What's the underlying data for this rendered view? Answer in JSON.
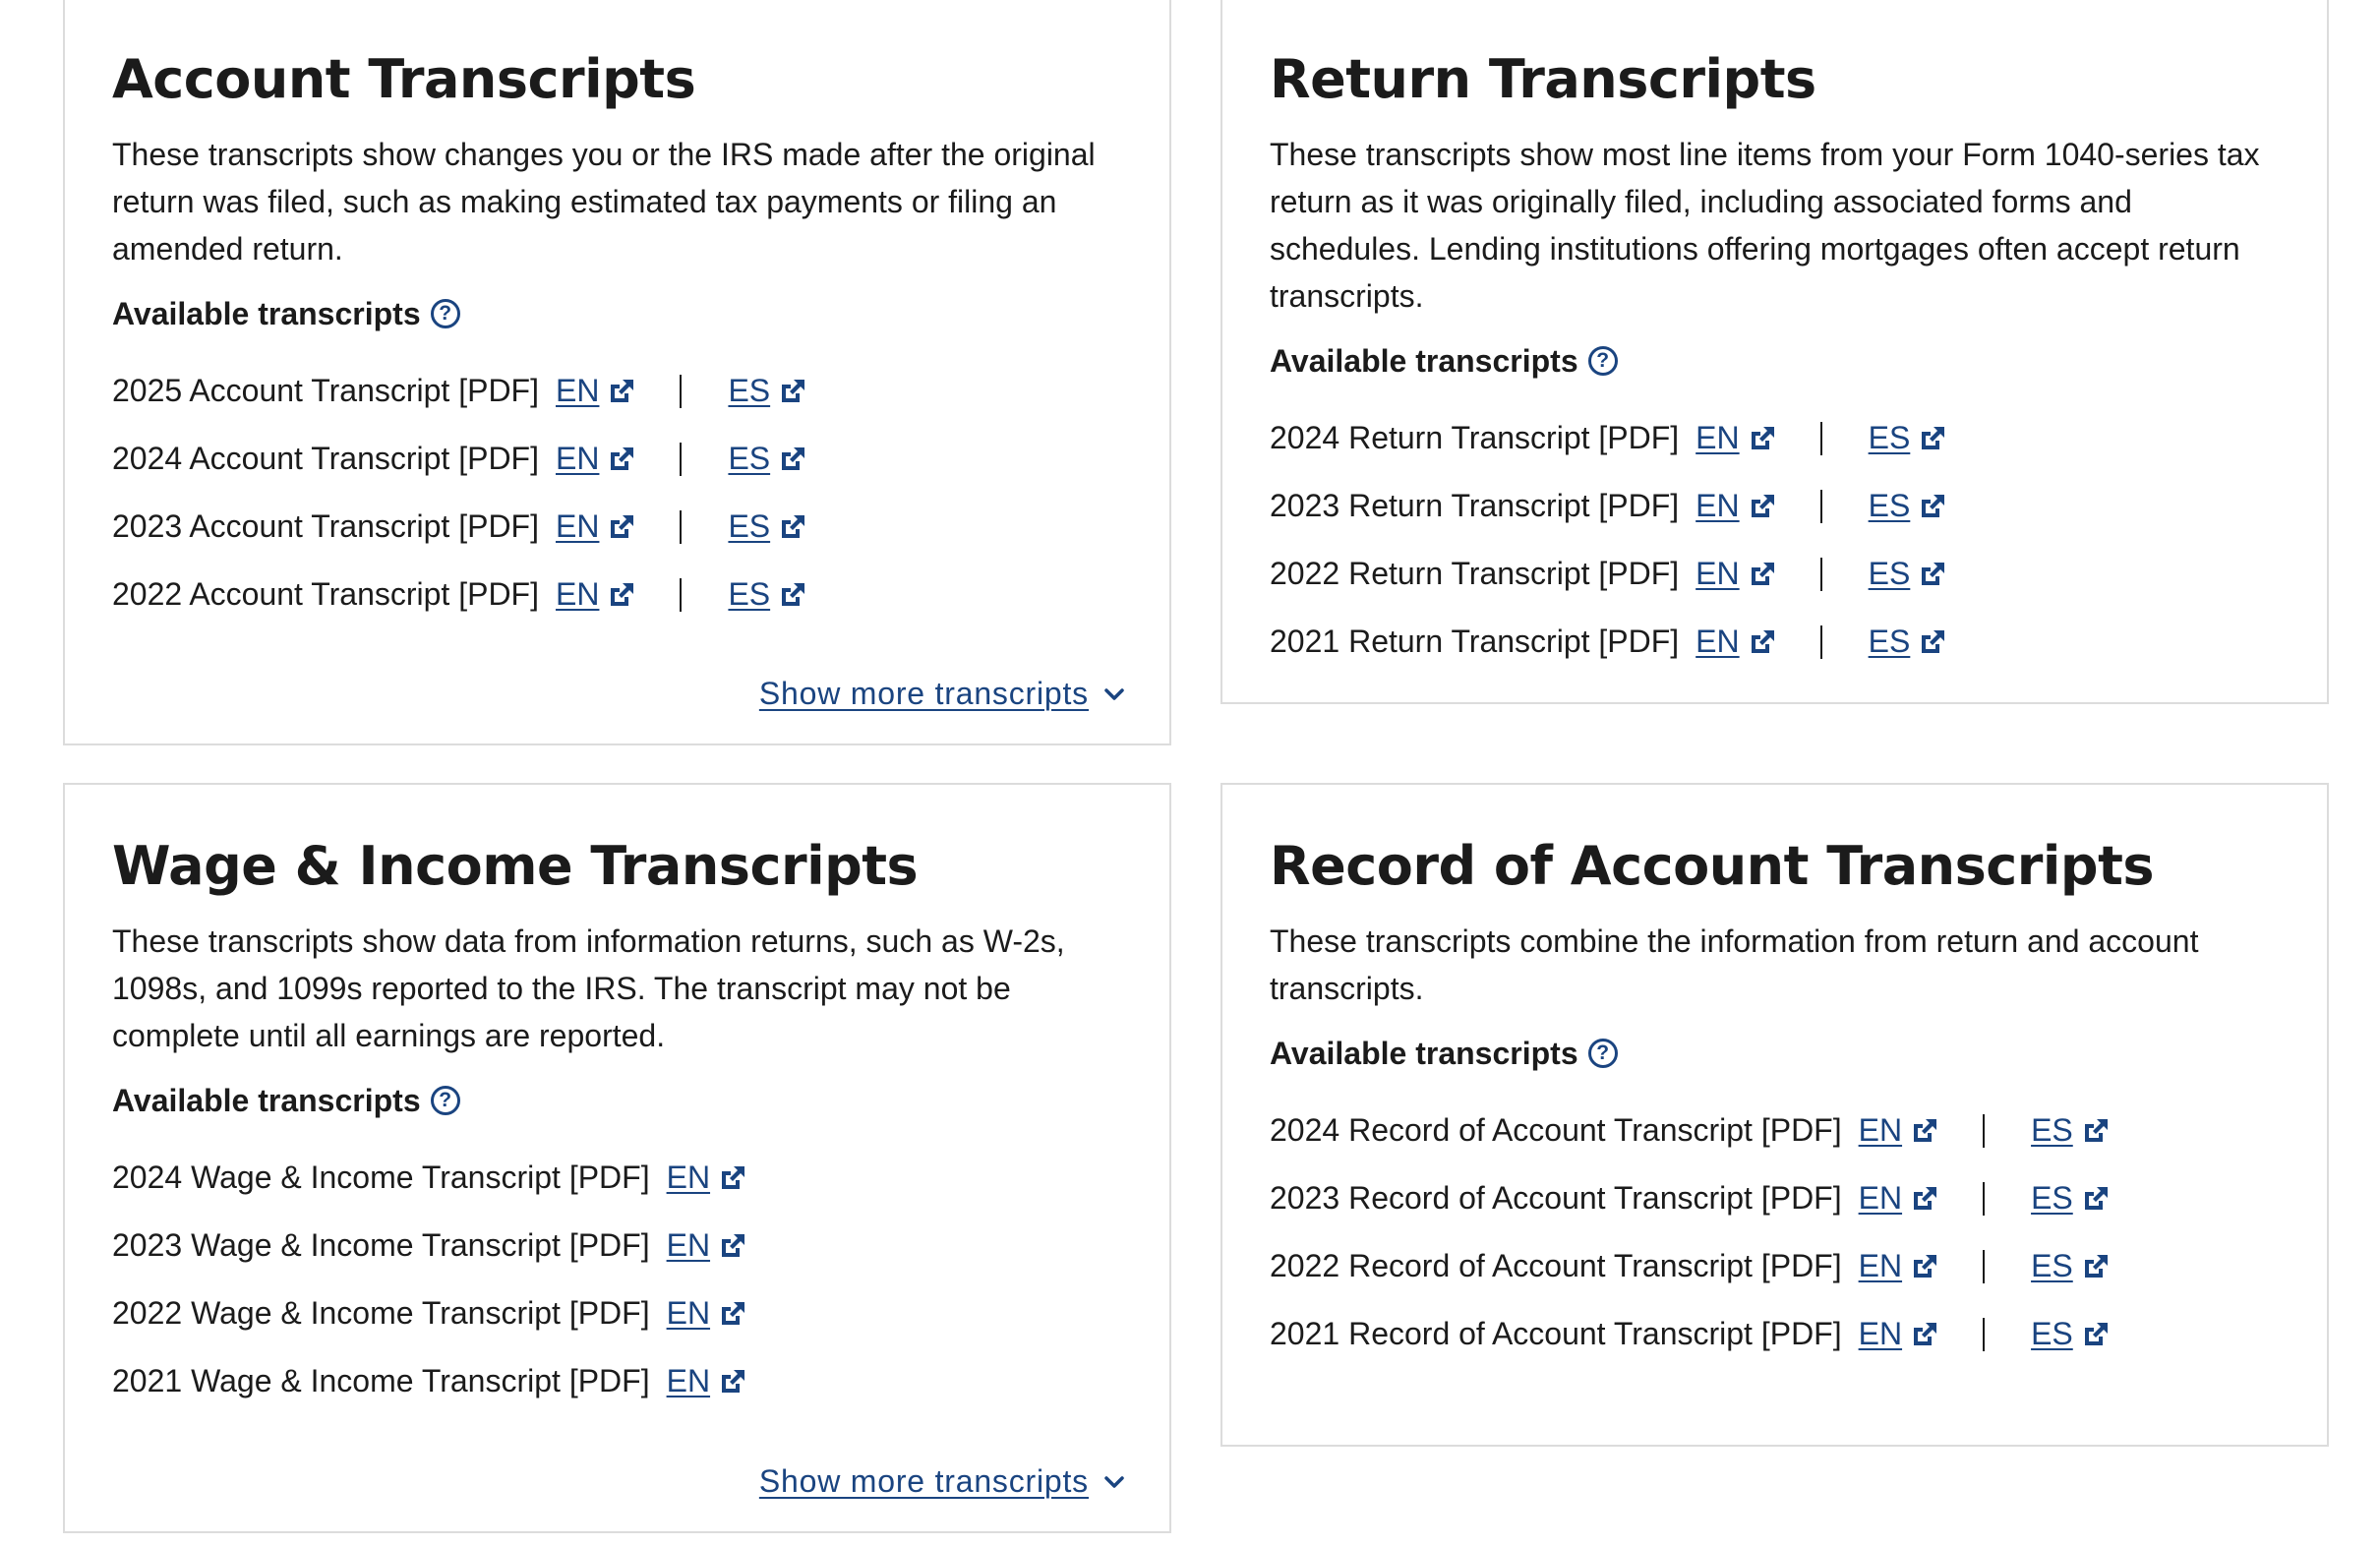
{
  "colors": {
    "link": "#1a4480",
    "text": "#1b1b1b",
    "border": "#dcdcdc"
  },
  "cards": {
    "account": {
      "title": "Account Transcripts",
      "description": "These transcripts show changes you or the IRS made after the original return was filed, such as making estimated tax payments or filing an amended return.",
      "available_label": "Available transcripts",
      "help_icon": "?",
      "rows": [
        {
          "label": "2025 Account Transcript [PDF]",
          "en": "EN",
          "es": "ES"
        },
        {
          "label": "2024 Account Transcript [PDF]",
          "en": "EN",
          "es": "ES"
        },
        {
          "label": "2023 Account Transcript [PDF]",
          "en": "EN",
          "es": "ES"
        },
        {
          "label": "2022 Account Transcript [PDF]",
          "en": "EN",
          "es": "ES"
        }
      ],
      "show_more": "Show more transcripts"
    },
    "return": {
      "title": "Return Transcripts",
      "description": "These transcripts show most line items from your Form 1040-series tax return as it was originally filed, including associated forms and schedules. Lending institutions offering mortgages often accept return transcripts.",
      "available_label": "Available transcripts",
      "help_icon": "?",
      "rows": [
        {
          "label": "2024 Return Transcript [PDF]",
          "en": "EN",
          "es": "ES"
        },
        {
          "label": "2023 Return Transcript [PDF]",
          "en": "EN",
          "es": "ES"
        },
        {
          "label": "2022 Return Transcript [PDF]",
          "en": "EN",
          "es": "ES"
        },
        {
          "label": "2021 Return Transcript [PDF]",
          "en": "EN",
          "es": "ES"
        }
      ]
    },
    "wage": {
      "title": "Wage & Income Transcripts",
      "description": "These transcripts show data from information returns, such as W-2s, 1098s, and 1099s reported to the IRS. The transcript may not be complete until all earnings are reported.",
      "available_label": "Available transcripts",
      "help_icon": "?",
      "rows": [
        {
          "label": "2024 Wage & Income Transcript [PDF]",
          "en": "EN"
        },
        {
          "label": "2023 Wage & Income Transcript [PDF]",
          "en": "EN"
        },
        {
          "label": "2022 Wage & Income Transcript [PDF]",
          "en": "EN"
        },
        {
          "label": "2021 Wage & Income Transcript [PDF]",
          "en": "EN"
        }
      ],
      "show_more": "Show more transcripts"
    },
    "record": {
      "title": "Record of Account Transcripts",
      "description": "These transcripts combine the information from return and account transcripts.",
      "available_label": "Available transcripts",
      "help_icon": "?",
      "rows": [
        {
          "label": "2024 Record of Account Transcript [PDF]",
          "en": "EN",
          "es": "ES"
        },
        {
          "label": "2023 Record of Account Transcript [PDF]",
          "en": "EN",
          "es": "ES"
        },
        {
          "label": "2022 Record of Account Transcript [PDF]",
          "en": "EN",
          "es": "ES"
        },
        {
          "label": "2021 Record of Account Transcript [PDF]",
          "en": "EN",
          "es": "ES"
        }
      ]
    }
  }
}
